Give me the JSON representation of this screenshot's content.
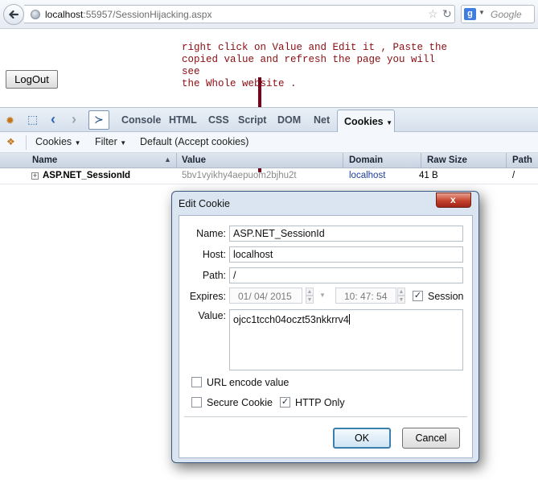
{
  "browser": {
    "url_host": "localhost",
    "url_path": ":55957/SessionHijacking.aspx",
    "search_placeholder": "Google"
  },
  "page": {
    "logout_label": "LogOut",
    "annotation": "right click on Value and Edit it , Paste the\ncopied value and refresh the page you will see\nthe Whole website ."
  },
  "firebug": {
    "tabs": [
      "Console",
      "HTML",
      "CSS",
      "Script",
      "DOM",
      "Net"
    ],
    "active_tab": "Cookies",
    "sub_menu": {
      "cookies": "Cookies",
      "filter": "Filter",
      "policy": "Default (Accept cookies)"
    },
    "columns": [
      "Name",
      "Value",
      "Domain",
      "Raw Size",
      "Path"
    ],
    "row": {
      "name": "ASP.NET_SessionId",
      "value": "5bv1vyikhy4aepuom2bjhu2t",
      "domain": "localhost",
      "size": "41 B",
      "path": "/"
    }
  },
  "dialog": {
    "title": "Edit Cookie",
    "close_glyph": "x",
    "labels": {
      "name": "Name:",
      "host": "Host:",
      "path": "Path:",
      "expires": "Expires:",
      "value": "Value:"
    },
    "fields": {
      "name": "ASP.NET_SessionId",
      "host": "localhost",
      "path": "/",
      "expires_date": "01/ 04/  2015",
      "expires_time": "10: 47: 54",
      "value": "ojcc1tcch04oczt53nkkrrv4"
    },
    "checkboxes": {
      "session": {
        "label": "Session",
        "checked": true
      },
      "url_encode": {
        "label": "URL encode value",
        "checked": false
      },
      "secure": {
        "label": "Secure Cookie",
        "checked": false
      },
      "http_only": {
        "label": "HTTP Only",
        "checked": true
      }
    },
    "ok_label": "OK",
    "cancel_label": "Cancel"
  }
}
